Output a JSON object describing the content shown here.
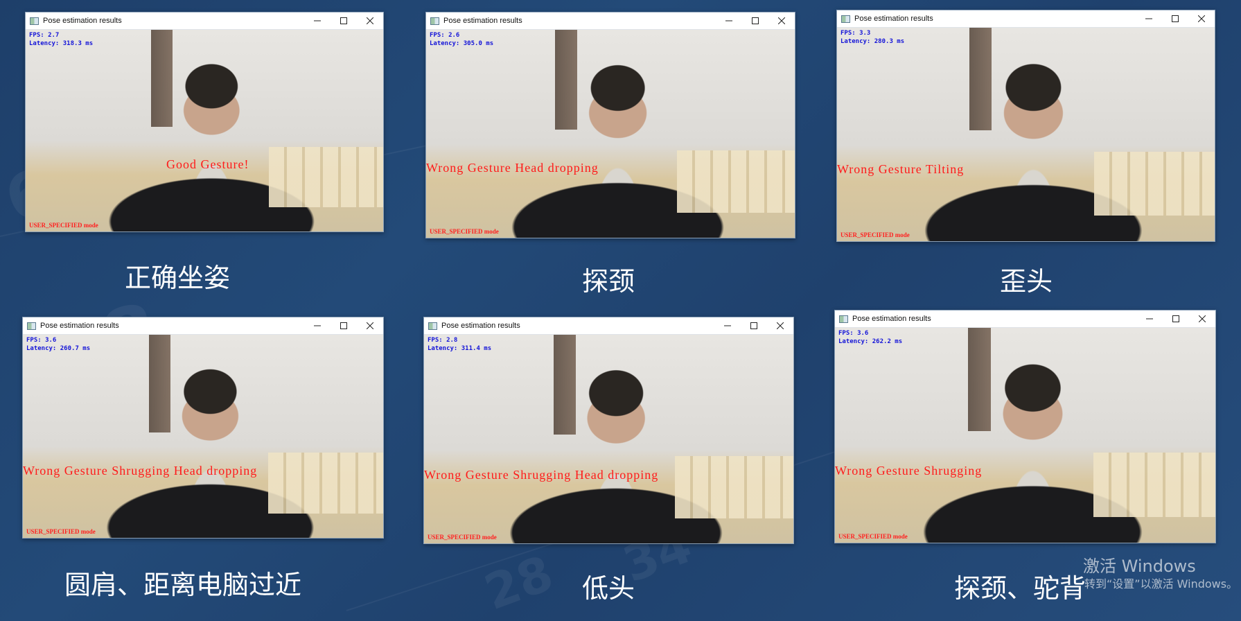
{
  "windows": [
    {
      "title": "Pose estimation results",
      "fps": "FPS: 2.7",
      "latency": "Latency: 318.3 ms",
      "gesture": "Good Gesture!",
      "mode": "USER_SPECIFIED mode"
    },
    {
      "title": "Pose estimation results",
      "fps": "FPS: 2.6",
      "latency": "Latency: 305.0 ms",
      "gesture": "Wrong Gesture Head dropping",
      "mode": "USER_SPECIFIED mode"
    },
    {
      "title": "Pose estimation results",
      "fps": "FPS: 3.3",
      "latency": "Latency: 280.3 ms",
      "gesture": "Wrong Gesture Tilting",
      "mode": "USER_SPECIFIED mode"
    },
    {
      "title": "Pose estimation results",
      "fps": "FPS: 3.6",
      "latency": "Latency: 260.7 ms",
      "gesture": "Wrong Gesture Shrugging Head dropping",
      "mode": "USER_SPECIFIED mode"
    },
    {
      "title": "Pose estimation results",
      "fps": "FPS: 2.8",
      "latency": "Latency: 311.4 ms",
      "gesture": "Wrong Gesture Shrugging Head dropping",
      "mode": "USER_SPECIFIED mode"
    },
    {
      "title": "Pose estimation results",
      "fps": "FPS: 3.6",
      "latency": "Latency: 262.2 ms",
      "gesture": "Wrong Gesture Shrugging",
      "mode": "USER_SPECIFIED mode"
    }
  ],
  "captions": [
    "正确坐姿",
    "探颈",
    "歪头",
    "圆肩、距离电脑过近",
    "低头",
    "探颈、驼背"
  ],
  "watermark": {
    "line1": "激活 Windows",
    "line2": "转到“设置”以激活 Windows。"
  },
  "colors": {
    "background": "#234a78",
    "fps_text": "#1414d8",
    "gesture_text": "#ff1a1a",
    "caption": "#ffffff"
  }
}
